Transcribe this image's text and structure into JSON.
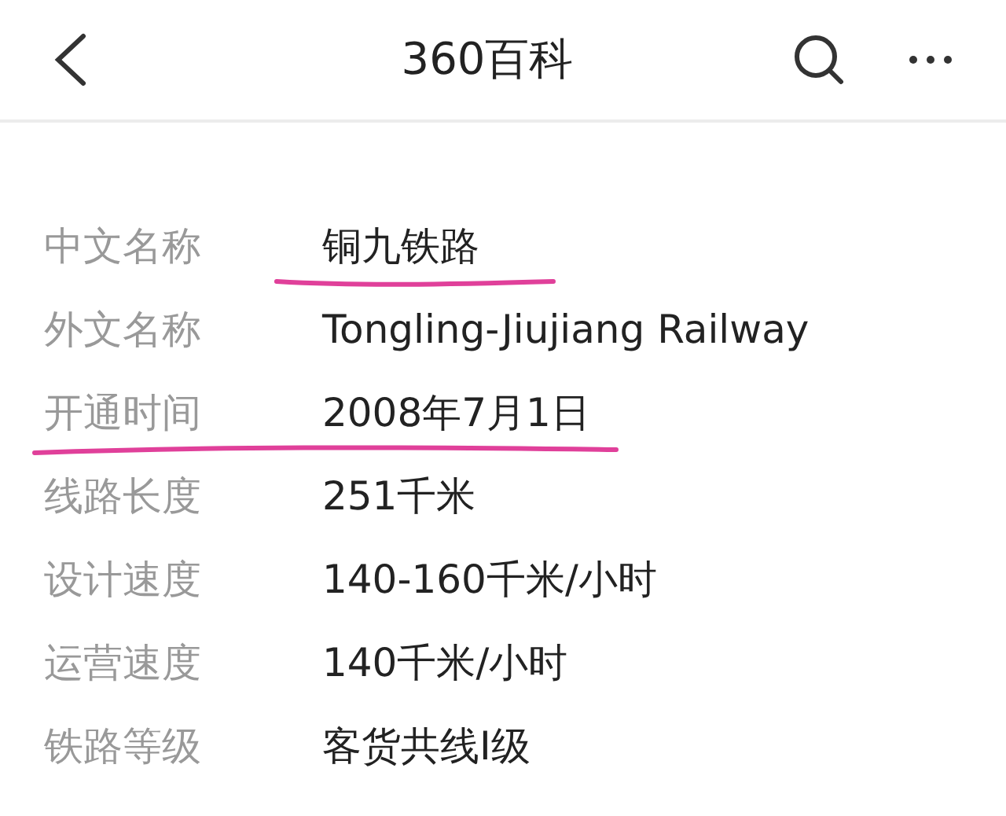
{
  "header": {
    "title": "360百科"
  },
  "rows": [
    {
      "label": "中文名称",
      "value": "铜九铁路",
      "label_underlined": false,
      "value_underlined": true
    },
    {
      "label": "外文名称",
      "value": "Tongling-Jiujiang Railway",
      "label_underlined": false,
      "value_underlined": false
    },
    {
      "label": "开通时间",
      "value": "2008年7月1日",
      "label_underlined": true,
      "value_underlined": true
    },
    {
      "label": "线路长度",
      "value": "251千米",
      "label_underlined": false,
      "value_underlined": false
    },
    {
      "label": "设计速度",
      "value": "140-160千米/小时",
      "label_underlined": false,
      "value_underlined": false
    },
    {
      "label": "运营速度",
      "value": "140千米/小时",
      "label_underlined": false,
      "value_underlined": false
    },
    {
      "label": "铁路等级",
      "value": "客货共线I级",
      "label_underlined": false,
      "value_underlined": false
    }
  ]
}
